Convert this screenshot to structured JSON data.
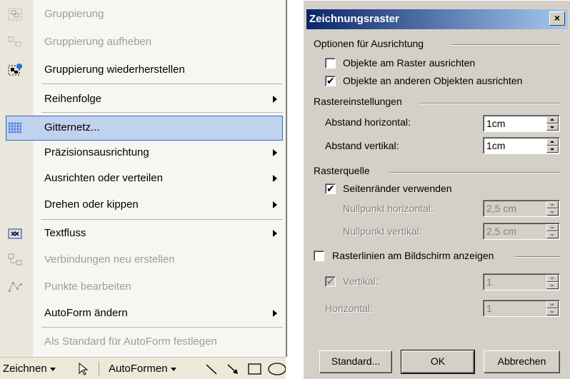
{
  "menu": {
    "items": [
      {
        "label": "Gruppierung",
        "disabled": true,
        "icon": "group-icon"
      },
      {
        "label": "Gruppierung aufheben",
        "disabled": true,
        "icon": "ungroup-icon"
      },
      {
        "label": "Gruppierung wiederherstellen",
        "disabled": false,
        "icon": "regroup-icon"
      },
      {
        "label": "Reihenfolge",
        "disabled": false,
        "submenu": true
      },
      {
        "label": "Gitternetz...",
        "disabled": false,
        "selected": true,
        "icon": "grid-icon"
      },
      {
        "label": "Präzisionsausrichtung",
        "disabled": false,
        "submenu": true
      },
      {
        "label": "Ausrichten oder verteilen",
        "disabled": false,
        "submenu": true
      },
      {
        "label": "Drehen oder kippen",
        "disabled": false,
        "submenu": true
      },
      {
        "label": "Textfluss",
        "disabled": false,
        "submenu": true,
        "icon": "textwrap-icon"
      },
      {
        "label": "Verbindungen neu erstellen",
        "disabled": true,
        "icon": "reroute-connectors-icon"
      },
      {
        "label": "Punkte bearbeiten",
        "disabled": true,
        "icon": "edit-points-icon"
      },
      {
        "label": "AutoForm ändern",
        "disabled": false,
        "submenu": true
      },
      {
        "label": "Als Standard für AutoForm festlegen",
        "disabled": true
      }
    ]
  },
  "toolbar": {
    "draw_label": "Zeichnen",
    "autoshapes_label": "AutoFormen"
  },
  "dialog": {
    "title": "Zeichnungsraster",
    "close_glyph": "×",
    "group_snap": "Optionen für Ausrichtung",
    "snap_to_grid": {
      "label": "Objekte am Raster ausrichten",
      "checked": false
    },
    "snap_to_objects": {
      "label": "Objekte an anderen Objekten ausrichten",
      "checked": true
    },
    "group_grid": "Rastereinstellungen",
    "spacing_h": {
      "label": "Abstand horizontal:",
      "value": "1cm"
    },
    "spacing_v": {
      "label": "Abstand vertikal:",
      "value": "1cm"
    },
    "group_origin": "Rasterquelle",
    "use_margins": {
      "label": "Seitenränder verwenden",
      "checked": true
    },
    "origin_h": {
      "label": "Nullpunkt horizontal:",
      "value": "2,5 cm"
    },
    "origin_v": {
      "label": "Nullpunkt vertikal:",
      "value": "2,5 cm"
    },
    "show_gridlines": {
      "label": "Rasterlinien am Bildschirm anzeigen",
      "checked": false
    },
    "vertical": {
      "label": "Vertikal:",
      "value": "1",
      "checked": true
    },
    "horizontal": {
      "label": "Horizontal:",
      "value": "1"
    },
    "btn_default": "Standard...",
    "btn_ok": "OK",
    "btn_cancel": "Abbrechen"
  },
  "colors": {
    "titlebar_start": "#0a246a",
    "titlebar_end": "#a6caf0",
    "selection": "#c1d2ee",
    "selection_border": "#316ac5",
    "dialog_face": "#d4d0c8"
  }
}
